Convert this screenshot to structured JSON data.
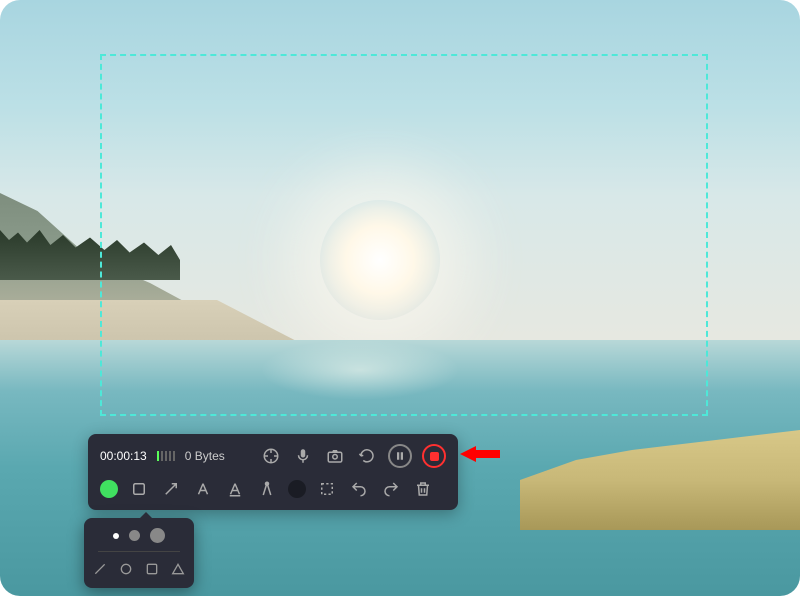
{
  "recorder": {
    "timer": "00:00:13",
    "file_size": "0 Bytes",
    "colors": {
      "active": "#40e060",
      "stop": "#ff3030",
      "selection_border": "#4ee8d8"
    },
    "tools_row1": [
      "cursor-highlight",
      "microphone",
      "camera",
      "refresh",
      "pause",
      "stop"
    ],
    "tools_row2": [
      "color-picker",
      "rectangle",
      "arrow",
      "text",
      "highlighter",
      "compass",
      "dark-color",
      "marquee",
      "undo",
      "redo",
      "delete"
    ]
  },
  "popup": {
    "sizes": [
      "small",
      "medium",
      "large"
    ],
    "shapes": [
      "line",
      "circle",
      "square",
      "triangle"
    ]
  }
}
